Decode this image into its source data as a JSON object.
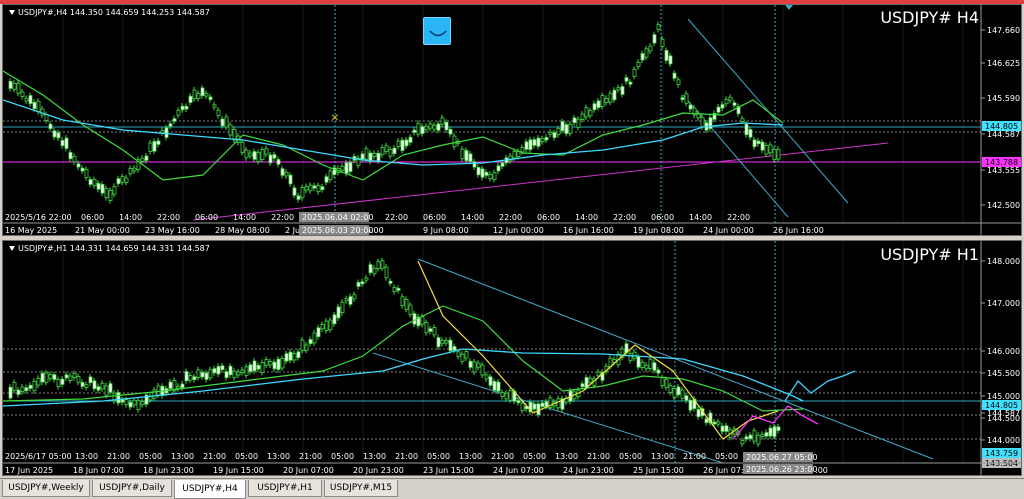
{
  "window": {
    "accent": "#e04040"
  },
  "h4": {
    "info": "USDJPY#,H4  144.350 144.659 144.253 144.587",
    "title": "USDJPY# H4",
    "price_labels": [
      "147.660",
      "146.625",
      "145.590",
      "144.587",
      "143.555",
      "142.500"
    ],
    "tag_cyan": "144.805",
    "tag_magenta": "143.788",
    "time_labels_top": [
      "2025/5/16 22:00",
      "06:00",
      "14:00",
      "22:00",
      "06:00",
      "14:00",
      "22:00",
      "06:00",
      "14:00",
      "22:00",
      "06:00",
      "14:00",
      "22:00",
      "06:00",
      "14:00",
      "22:00",
      "06:00",
      "14:00",
      "22:00"
    ],
    "date_labels": [
      "16 May 2025",
      "21 May 00:00",
      "23 May 16:00",
      "28 May 08:00",
      "2 Jun",
      "un 16:00",
      "9 Jun 08:00",
      "12 Jun 00:00",
      "16 Jun 16:00",
      "19 Jun 08:00",
      "24 Jun 00:00",
      "26 Jun 16:00"
    ],
    "cursor_time_top": "2025.06.04 02:00",
    "cursor_time_bottom": "2025.06.03 20:00"
  },
  "h1": {
    "info": "USDJPY#,H1  144.331 144.659 144.331 144.587",
    "title": "USDJPY# H1",
    "price_labels": [
      "148.000",
      "147.000",
      "146.000",
      "145.500",
      "145.000",
      "144.805",
      "144.587",
      "144.500",
      "144.000"
    ],
    "tag_cyan": "143.759",
    "tag_low": "143.504",
    "time_labels_top": [
      "2025/6/17 05:00",
      "13:00",
      "21:00",
      "05:00",
      "13:00",
      "21:00",
      "05:00",
      "13:00",
      "21:00",
      "05:00",
      "13:00",
      "21:00",
      "05:00",
      "13:00",
      "21:00",
      "05:00",
      "13:00",
      "21:00",
      "05:00",
      "13:00",
      "21:00",
      "05:00",
      "13:00"
    ],
    "date_labels": [
      "17 Jun 2025",
      "18 Jun 07:00",
      "18 Jun 23:00",
      "19 Jun 15:00",
      "20 Jun 07:00",
      "20 Jun 23:00",
      "23 Jun 15:00",
      "24 Jun 07:00",
      "24 Jun 23:00",
      "25 Jun 15:00",
      "26 Jun 07:"
    ],
    "cursor_time_top": "2025.06.27 05:00",
    "cursor_time_bottom": "2025.06.26 23:00",
    "date_tail": ":00"
  },
  "tabs": [
    {
      "label": "USDJPY#,Weekly",
      "active": false
    },
    {
      "label": "USDJPY#,Daily",
      "active": false
    },
    {
      "label": "USDJPY#,H4",
      "active": true
    },
    {
      "label": "USDJPY#,H1",
      "active": false
    },
    {
      "label": "USDJPY#,M15",
      "active": false
    }
  ],
  "icons": {
    "indicator_button": "wave-indicator-icon",
    "info_marker": "triangle-down-icon"
  }
}
